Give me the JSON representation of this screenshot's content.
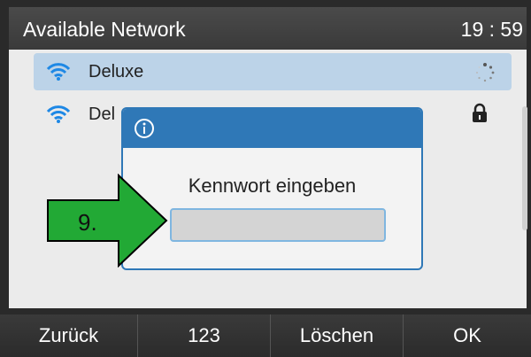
{
  "header": {
    "title": "Available Network",
    "time": "19 : 59"
  },
  "networks": [
    {
      "name": "Deluxe",
      "icon": "wifi-icon",
      "status_icon": "loading-spinner-icon",
      "selected": true
    },
    {
      "name": "Del",
      "icon": "wifi-icon",
      "status_icon": "lock-icon",
      "selected": false
    }
  ],
  "dialog": {
    "icon": "info-icon",
    "prompt": "Kennwort eingeben",
    "input_value": ""
  },
  "annotation": {
    "label": "9.",
    "color": "#22a935"
  },
  "softkeys": [
    {
      "label": "Zurück"
    },
    {
      "label": "123"
    },
    {
      "label": "Löschen"
    },
    {
      "label": "OK"
    }
  ],
  "colors": {
    "accent": "#2f78b7",
    "selected_row": "#bcd3e8"
  }
}
